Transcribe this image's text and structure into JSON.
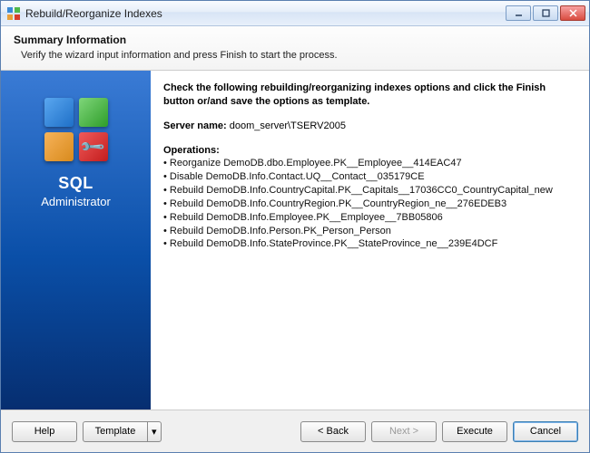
{
  "window": {
    "title": "Rebuild/Reorganize Indexes"
  },
  "header": {
    "title": "Summary Information",
    "subtitle": "Verify the wizard input information and press Finish to start the process."
  },
  "sidebar": {
    "product_line1": "SQL",
    "product_line2": "Administrator"
  },
  "content": {
    "instruction": "Check the following rebuilding/reorganizing indexes options and click the Finish button or/and save the options as template.",
    "server_label": "Server name:",
    "server_value": "doom_server\\TSERV2005",
    "operations_label": "Operations:",
    "operations": [
      "Reorganize DemoDB.dbo.Employee.PK__Employee__414EAC47",
      "Disable DemoDB.Info.Contact.UQ__Contact__035179CE",
      "Rebuild DemoDB.Info.CountryCapital.PK__Capitals__17036CC0_CountryCapital_new",
      "Rebuild DemoDB.Info.CountryRegion.PK__CountryRegion_ne__276EDEB3",
      "Rebuild DemoDB.Info.Employee.PK__Employee__7BB05806",
      "Rebuild DemoDB.Info.Person.PK_Person_Person",
      "Rebuild DemoDB.Info.StateProvince.PK__StateProvince_ne__239E4DCF"
    ]
  },
  "footer": {
    "help": "Help",
    "template": "Template",
    "back": "< Back",
    "next": "Next >",
    "execute": "Execute",
    "cancel": "Cancel"
  },
  "icons": {
    "dropdown": "▾"
  }
}
